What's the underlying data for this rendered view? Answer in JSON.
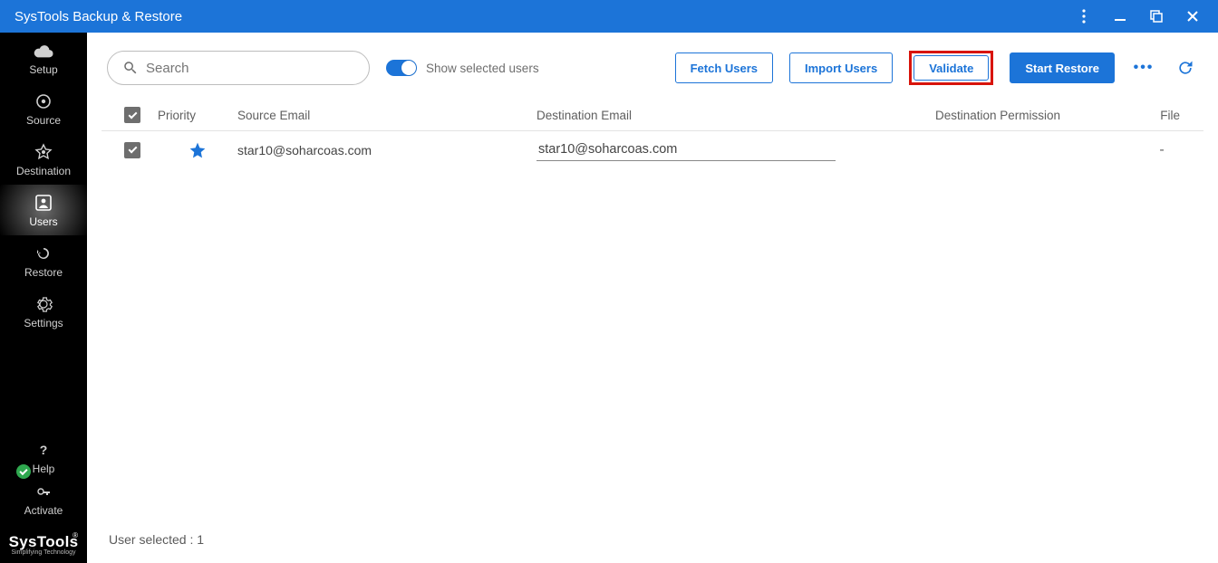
{
  "window": {
    "title": "SysTools Backup & Restore"
  },
  "sidebar": {
    "items": [
      {
        "label": "Setup"
      },
      {
        "label": "Source"
      },
      {
        "label": "Destination"
      },
      {
        "label": "Users"
      },
      {
        "label": "Restore"
      },
      {
        "label": "Settings"
      }
    ],
    "help_label": "Help",
    "activate_label": "Activate",
    "brand": "SysTools",
    "brand_tag": "Simplifying Technology"
  },
  "toolbar": {
    "search_placeholder": "Search",
    "toggle_label": "Show selected users",
    "fetch_label": "Fetch Users",
    "import_label": "Import Users",
    "validate_label": "Validate",
    "start_label": "Start Restore"
  },
  "table": {
    "headers": {
      "priority": "Priority",
      "source": "Source Email",
      "destination": "Destination Email",
      "permission": "Destination Permission",
      "file": "File"
    },
    "rows": [
      {
        "source_email": "star10@soharcoas.com",
        "destination_email": "star10@soharcoas.com",
        "permission": "",
        "file": "-"
      }
    ]
  },
  "footer": {
    "selected_text": "User selected : 1"
  }
}
